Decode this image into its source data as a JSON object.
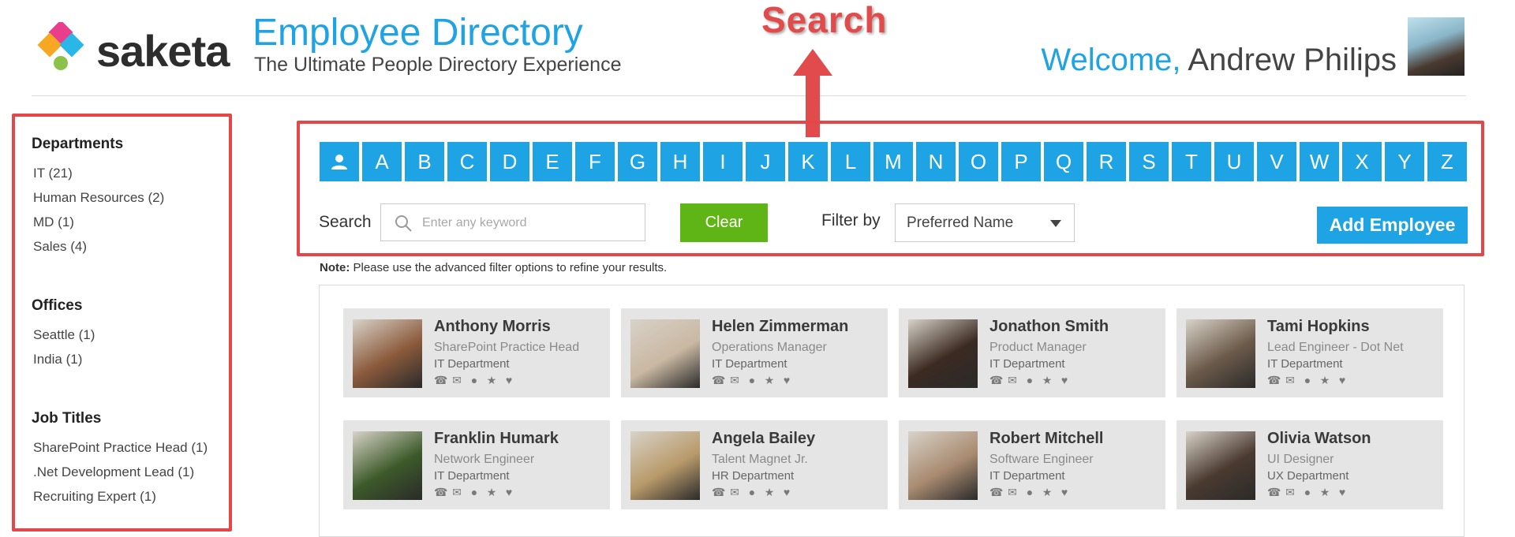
{
  "header": {
    "brand": "saketa",
    "title": "Employee Directory",
    "subtitle": "The Ultimate People Directory Experience",
    "welcome_prefix": "Welcome,",
    "user_name": "Andrew Philips"
  },
  "callout": {
    "label": "Search",
    "color": "#e24b4b"
  },
  "sidebar": {
    "sections": [
      {
        "heading": "Departments",
        "items": [
          "IT (21)",
          "Human Resources (2)",
          "MD (1)",
          "Sales (4)"
        ]
      },
      {
        "heading": "Offices",
        "items": [
          "Seattle (1)",
          "India (1)"
        ]
      },
      {
        "heading": "Job Titles",
        "items": [
          "SharePoint Practice Head (1)",
          ".Net Development Lead (1)",
          "Recruiting Expert (1)"
        ]
      }
    ]
  },
  "search": {
    "alphabet": [
      "A",
      "B",
      "C",
      "D",
      "E",
      "F",
      "G",
      "H",
      "I",
      "J",
      "K",
      "L",
      "M",
      "N",
      "O",
      "P",
      "Q",
      "R",
      "S",
      "T",
      "U",
      "V",
      "W",
      "X",
      "Y",
      "Z"
    ],
    "all_icon": "person-icon",
    "label": "Search",
    "placeholder": "Enter any keyword",
    "clear_label": "Clear",
    "filter_label": "Filter by",
    "filter_value": "Preferred Name",
    "add_label": "Add Employee",
    "note_bold": "Note:",
    "note_text": " Please use the advanced filter options to refine your results."
  },
  "employees": [
    {
      "name": "Anthony Morris",
      "role": "SharePoint Practice Head",
      "dept": "IT Department",
      "photo": "#8b5a3c"
    },
    {
      "name": "Helen Zimmerman",
      "role": "Operations Manager",
      "dept": "IT Department",
      "photo": "#c9b8a2"
    },
    {
      "name": "Jonathon Smith",
      "role": "Product Manager",
      "dept": "IT Department",
      "photo": "#3b2a22"
    },
    {
      "name": "Tami Hopkins",
      "role": "Lead Engineer - Dot Net",
      "dept": "IT Department",
      "photo": "#6b5a4a"
    },
    {
      "name": "Franklin Humark",
      "role": "Network Engineer",
      "dept": "IT Department",
      "photo": "#3d5a2a"
    },
    {
      "name": "Angela Bailey",
      "role": "Talent Magnet Jr.",
      "dept": "HR Department",
      "photo": "#b89a6a"
    },
    {
      "name": "Robert Mitchell",
      "role": "Software Engineer",
      "dept": "IT Department",
      "photo": "#a88a70"
    },
    {
      "name": "Olivia Watson",
      "role": "UI Designer",
      "dept": "UX Department",
      "photo": "#4a3a30"
    }
  ],
  "card_icons": [
    "phone-icon",
    "mail-icon",
    "chat-icon",
    "star-icon",
    "heart-icon"
  ],
  "colors": {
    "accent": "#1ea4e5",
    "clear": "#5fb515",
    "highlight": "#e3474a"
  }
}
